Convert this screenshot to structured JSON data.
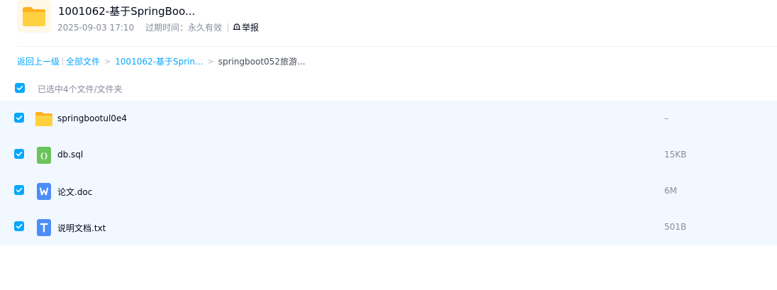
{
  "share": {
    "title": "1001062-基于SpringBoo...",
    "date": "2025-09-03 17:10",
    "expire_label": "过期时间：",
    "expire_value": "永久有效",
    "report_label": "举报"
  },
  "breadcrumb": {
    "back": "返回上一级",
    "all_files": "全部文件",
    "arrow": ">",
    "folder": "1001062-基于Sprin...",
    "current": "springboot052旅游..."
  },
  "selection": {
    "text": "已选中4个文件/文件夹"
  },
  "files": [
    {
      "name": "springbootul0e4",
      "size": "–",
      "icon": "folder-icon",
      "checked": true
    },
    {
      "name": "db.sql",
      "size": "15KB",
      "icon": "code-file-icon",
      "checked": true
    },
    {
      "name": "论文.doc",
      "size": "6M",
      "icon": "word-file-icon",
      "checked": true
    },
    {
      "name": "说明文档.txt",
      "size": "501B",
      "icon": "text-file-icon",
      "checked": true
    }
  ],
  "colors": {
    "accent": "#06a7ff",
    "row_selected_bg": "#f2f8ff",
    "folder": "#ffc830",
    "code_file": "#6ac35c",
    "word_file": "#4d8df7",
    "text_file": "#4d8df7"
  }
}
